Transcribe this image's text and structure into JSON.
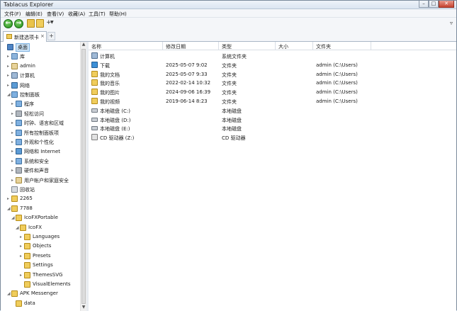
{
  "window": {
    "title": "Tablacus Explorer",
    "controls": [
      "–",
      "□",
      "✕"
    ]
  },
  "menu": [
    "文件(F)",
    "编辑(E)",
    "查看(V)",
    "收藏(A)",
    "工具(T)",
    "帮助(H)"
  ],
  "toolbar": {
    "back_icon": "back-arrow-icon",
    "forward_icon": "forward-arrow-icon",
    "address_value": "",
    "filter_icon": "filter-icon"
  },
  "tabs": [
    {
      "label": "新建选项卡",
      "close": "×"
    }
  ],
  "tree": [
    {
      "label": "桌面",
      "icon": "desktop",
      "depth": 0,
      "toggle": "",
      "selected": true
    },
    {
      "label": "库",
      "icon": "lib",
      "depth": 1,
      "toggle": "▸"
    },
    {
      "label": "admin",
      "icon": "user",
      "depth": 1,
      "toggle": "▸"
    },
    {
      "label": "计算机",
      "icon": "pc",
      "depth": 1,
      "toggle": "▸"
    },
    {
      "label": "网络",
      "icon": "net",
      "depth": 1,
      "toggle": "▸"
    },
    {
      "label": "控制面板",
      "icon": "cp",
      "depth": 1,
      "toggle": "◢"
    },
    {
      "label": "程序",
      "icon": "cp",
      "depth": 2,
      "toggle": "▸"
    },
    {
      "label": "轻松访问",
      "icon": "gear",
      "depth": 2,
      "toggle": "▸"
    },
    {
      "label": "时钟、语言和区域",
      "icon": "cp",
      "depth": 2,
      "toggle": "▸"
    },
    {
      "label": "所有控制面板项",
      "icon": "cp",
      "depth": 2,
      "toggle": "▸"
    },
    {
      "label": "外观和个性化",
      "icon": "cp",
      "depth": 2,
      "toggle": "▸"
    },
    {
      "label": "网络和 Internet",
      "icon": "net",
      "depth": 2,
      "toggle": "▸"
    },
    {
      "label": "系统和安全",
      "icon": "cp",
      "depth": 2,
      "toggle": "▸"
    },
    {
      "label": "硬件和声音",
      "icon": "gear",
      "depth": 2,
      "toggle": "▸"
    },
    {
      "label": "用户帐户和家庭安全",
      "icon": "user",
      "depth": 2,
      "toggle": "▸"
    },
    {
      "label": "回收站",
      "icon": "bin",
      "depth": 1,
      "toggle": ""
    },
    {
      "label": "2265",
      "icon": "folder",
      "depth": 1,
      "toggle": "▸"
    },
    {
      "label": "7788",
      "icon": "folder",
      "depth": 1,
      "toggle": "◢"
    },
    {
      "label": "IcoFXPortable",
      "icon": "folder",
      "depth": 2,
      "toggle": "◢"
    },
    {
      "label": "IcoFX",
      "icon": "folder",
      "depth": 3,
      "toggle": "◢"
    },
    {
      "label": "Languages",
      "icon": "folder",
      "depth": 4,
      "toggle": "▸"
    },
    {
      "label": "Objects",
      "icon": "folder",
      "depth": 4,
      "toggle": "▸"
    },
    {
      "label": "Presets",
      "icon": "folder",
      "depth": 4,
      "toggle": "▸"
    },
    {
      "label": "Settings",
      "icon": "folder",
      "depth": 4,
      "toggle": ""
    },
    {
      "label": "ThemesSVG",
      "icon": "folder",
      "depth": 4,
      "toggle": "▸"
    },
    {
      "label": "VisualElements",
      "icon": "folder",
      "depth": 4,
      "toggle": ""
    },
    {
      "label": "APK Messenger",
      "icon": "folder",
      "depth": 1,
      "toggle": "◢"
    },
    {
      "label": "data",
      "icon": "folder",
      "depth": 2,
      "toggle": ""
    }
  ],
  "list": {
    "columns": [
      "名称",
      "修改日期",
      "类型",
      "大小",
      "文件夹"
    ],
    "rows": [
      {
        "name": "计算机",
        "icon": "pc",
        "date": "",
        "type": "系统文件夹",
        "size": "",
        "folder": ""
      },
      {
        "name": "下载",
        "icon": "dl",
        "date": "2025-05-07 9:02",
        "type": "文件夹",
        "size": "",
        "folder": "admin (C:\\Users)"
      },
      {
        "name": "我的文档",
        "icon": "folder",
        "date": "2025-05-07 9:33",
        "type": "文件夹",
        "size": "",
        "folder": "admin (C:\\Users)"
      },
      {
        "name": "我的音乐",
        "icon": "folder",
        "date": "2022-02-14 10:32",
        "type": "文件夹",
        "size": "",
        "folder": "admin (C:\\Users)"
      },
      {
        "name": "我的图片",
        "icon": "folder",
        "date": "2024-09-06 16:39",
        "type": "文件夹",
        "size": "",
        "folder": "admin (C:\\Users)"
      },
      {
        "name": "我的视频",
        "icon": "folder",
        "date": "2019-06-14 8:23",
        "type": "文件夹",
        "size": "",
        "folder": "admin (C:\\Users)"
      },
      {
        "name": "本地磁盘 (C:)",
        "icon": "drive",
        "date": "",
        "type": "本地磁盘",
        "size": "",
        "folder": ""
      },
      {
        "name": "本地磁盘 (D:)",
        "icon": "drive",
        "date": "",
        "type": "本地磁盘",
        "size": "",
        "folder": ""
      },
      {
        "name": "本地磁盘 (E:)",
        "icon": "drive",
        "date": "",
        "type": "本地磁盘",
        "size": "",
        "folder": ""
      },
      {
        "name": "CD 驱动器 (Z:)",
        "icon": "cd",
        "date": "",
        "type": "CD 驱动器",
        "size": "",
        "folder": ""
      }
    ]
  }
}
